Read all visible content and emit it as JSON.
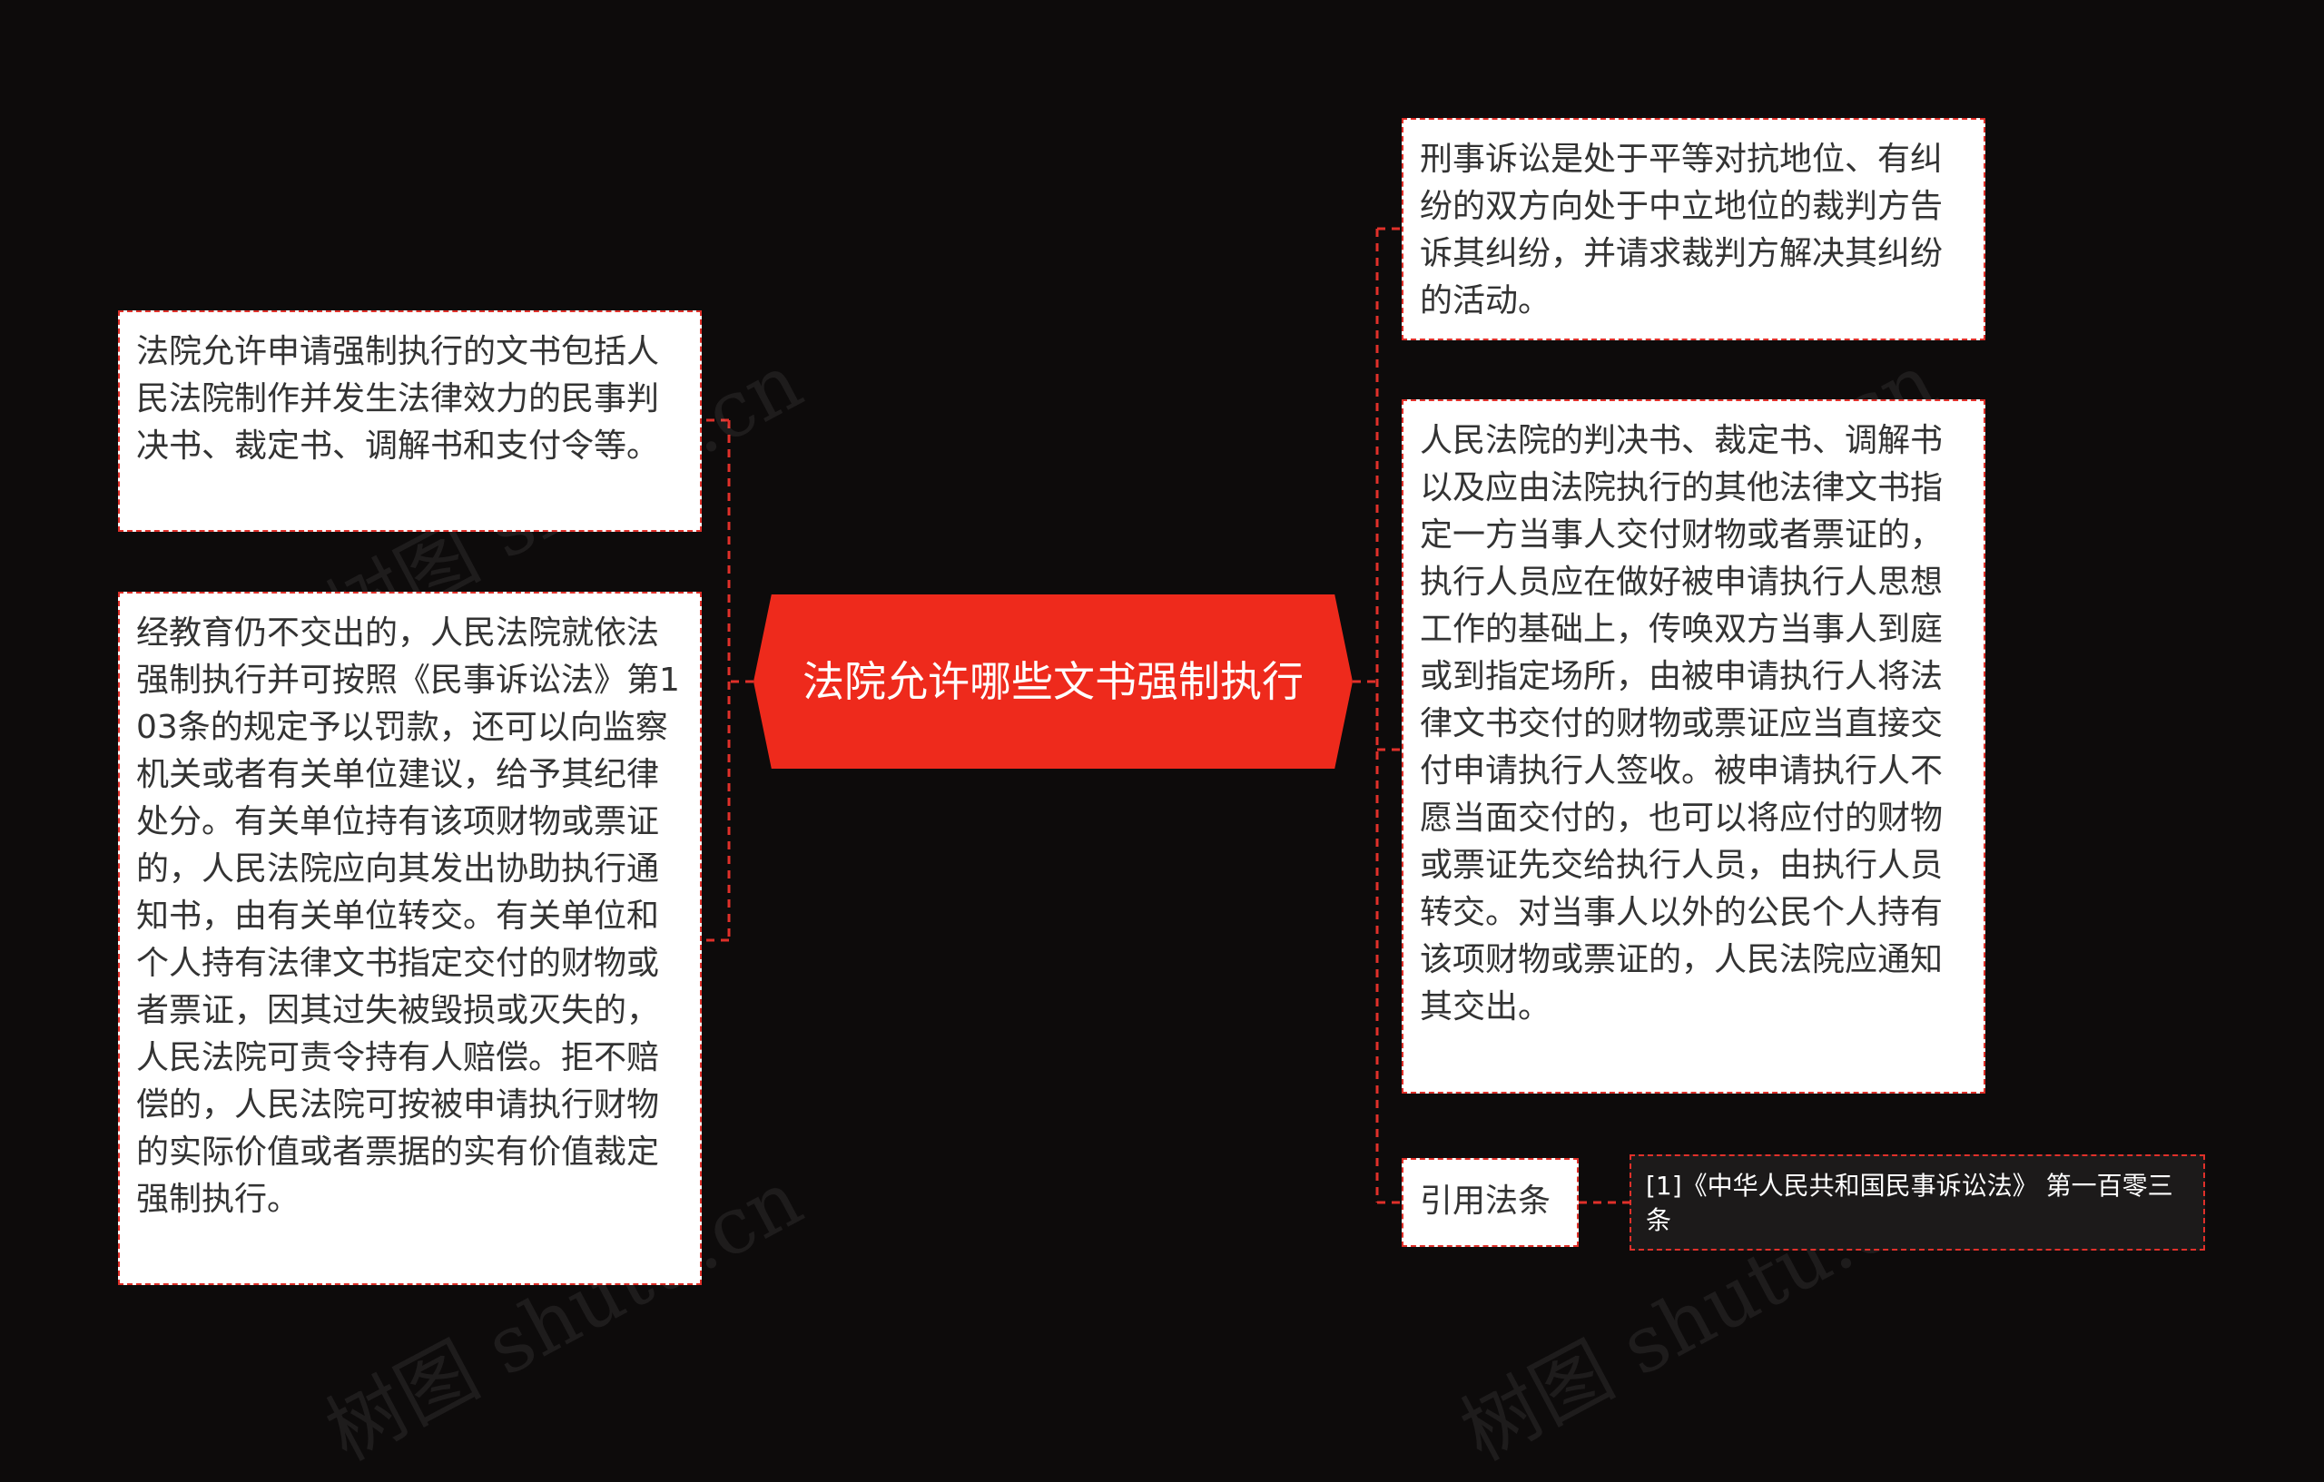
{
  "root": {
    "title": "法院允许哪些文书强制执行"
  },
  "left_nodes": [
    {
      "text": "法院允许申请强制执行的文书包括人民法院制作并发生法律效力的民事判决书、裁定书、调解书和支付令等。"
    },
    {
      "text": "经教育仍不交出的，人民法院就依法强制执行并可按照《民事诉讼法》第103条的规定予以罚款，还可以向监察机关或者有关单位建议，给予其纪律处分。有关单位持有该项财物或票证的，人民法院应向其发出协助执行通知书，由有关单位转交。有关单位和个人持有法律文书指定交付的财物或者票证，因其过失被毁损或灭失的，人民法院可责令持有人赔偿。拒不赔偿的，人民法院可按被申请执行财物的实际价值或者票据的实有价值裁定强制执行。"
    }
  ],
  "right_nodes": [
    {
      "text": "刑事诉讼是处于平等对抗地位、有纠纷的双方向处于中立地位的裁判方告诉其纠纷，并请求裁判方解决其纠纷的活动。"
    },
    {
      "text": "人民法院的判决书、裁定书、调解书以及应由法院执行的其他法律文书指定一方当事人交付财物或者票证的，执行人员应在做好被申请执行人思想工作的基础上，传唤双方当事人到庭或到指定场所，由被申请执行人将法律文书交付的财物或票证应当直接交付申请执行人签收。被申请执行人不愿当面交付的，也可以将应付的财物或票证先交给执行人员，由执行人员转交。对当事人以外的公民个人持有该项财物或票证的，人民法院应通知其交出。"
    },
    {
      "text": "引用法条"
    }
  ],
  "reference": {
    "text": "[1]《中华人民共和国民事诉讼法》 第一百零三条"
  },
  "watermark": {
    "text": "树图 shutu.cn"
  },
  "colors": {
    "background": "#0d0b0b",
    "root_fill": "#ee2a1c",
    "connector": "#e0302a",
    "node_fill": "#ffffff"
  }
}
